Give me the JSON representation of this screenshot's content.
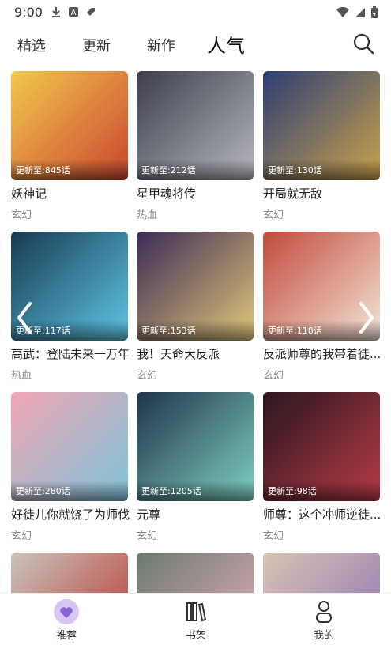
{
  "status_bar": {
    "time": "9:00",
    "left_icons": [
      "download-icon",
      "a-badge-icon",
      "tag-icon"
    ],
    "right_icons": [
      "wifi-icon",
      "signal-icon",
      "battery-icon"
    ]
  },
  "tabs": [
    {
      "label": "精选",
      "active": false
    },
    {
      "label": "更新",
      "active": false
    },
    {
      "label": "新作",
      "active": false
    },
    {
      "label": "人气",
      "active": true
    }
  ],
  "search": {
    "icon": "search-icon"
  },
  "comics": [
    {
      "title": "妖神记",
      "genre": "玄幻",
      "update": "更新至:845话",
      "colors": [
        "#f3c84d",
        "#c9452f"
      ]
    },
    {
      "title": "星甲魂将传",
      "genre": "热血",
      "update": "更新至:212话",
      "colors": [
        "#3a3f4a",
        "#b8b8bf"
      ]
    },
    {
      "title": "开局就无敌",
      "genre": "玄幻",
      "update": "更新至:130话",
      "colors": [
        "#2c3e75",
        "#c9a24c"
      ]
    },
    {
      "title": "高武：登陆未来一万年",
      "genre": "热血",
      "update": "更新至:117话",
      "colors": [
        "#163a52",
        "#5fc7e6"
      ]
    },
    {
      "title": "我！天命大反派",
      "genre": "玄幻",
      "update": "更新至:153话",
      "colors": [
        "#3b2a55",
        "#e0c77a"
      ]
    },
    {
      "title": "反派师尊的我带着徒...",
      "genre": "玄幻",
      "update": "更新至:118话",
      "colors": [
        "#c24a3a",
        "#f3e6d8"
      ]
    },
    {
      "title": "好徒儿你就饶了为师伐",
      "genre": "玄幻",
      "update": "更新至:280话",
      "colors": [
        "#f3a5b5",
        "#7fc5d9"
      ]
    },
    {
      "title": "元尊",
      "genre": "玄幻",
      "update": "更新至:1205话",
      "colors": [
        "#1f3448",
        "#7fd0c2"
      ]
    },
    {
      "title": "师尊：这个冲师逆徒...",
      "genre": "玄幻",
      "update": "更新至:98话",
      "colors": [
        "#2a1620",
        "#b63b46"
      ]
    },
    {
      "title": "",
      "genre": "",
      "update": "",
      "colors": [
        "#c9c4bd",
        "#b8312c"
      ]
    },
    {
      "title": "",
      "genre": "",
      "update": "",
      "colors": [
        "#6b7a6f",
        "#e8b0c0"
      ]
    },
    {
      "title": "",
      "genre": "",
      "update": "",
      "colors": [
        "#d9c4b3",
        "#8a6fb3"
      ]
    }
  ],
  "carousel": {
    "prev_icon": "chevron-left-icon",
    "next_icon": "chevron-right-icon"
  },
  "bottom_nav": [
    {
      "label": "推荐",
      "icon": "heart-icon",
      "active": true
    },
    {
      "label": "书架",
      "icon": "bookshelf-icon",
      "active": false
    },
    {
      "label": "我的",
      "icon": "person-icon",
      "active": false
    }
  ],
  "colors": {
    "accent": "#8a63d2",
    "accent_light": "#d7c6f4"
  }
}
